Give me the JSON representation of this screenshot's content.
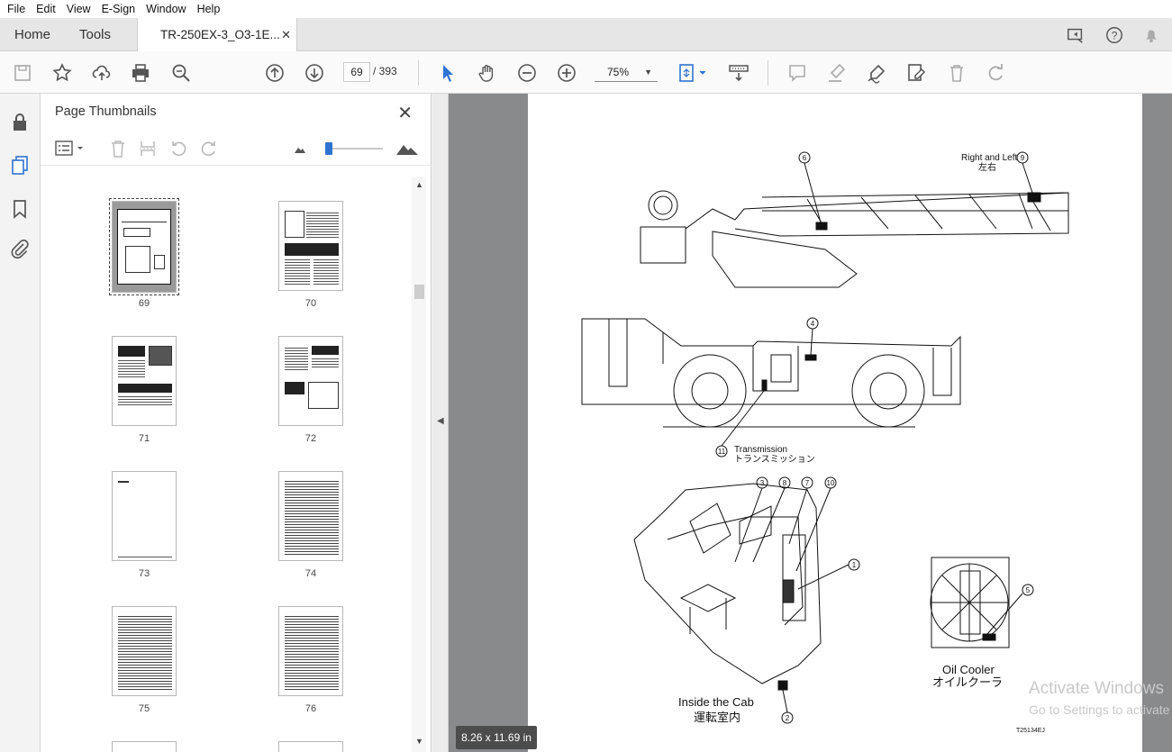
{
  "menu": [
    "File",
    "Edit",
    "View",
    "E-Sign",
    "Window",
    "Help"
  ],
  "tabs": {
    "home": "Home",
    "tools": "Tools",
    "document": "TR-250EX-3_O3-1E..."
  },
  "toolbar": {
    "current_page": "69",
    "page_total": "/ 393",
    "zoom": "75%"
  },
  "panel": {
    "title": "Page Thumbnails",
    "thumbnails": [
      {
        "label": "69",
        "selected": true
      },
      {
        "label": "70",
        "selected": false
      },
      {
        "label": "71",
        "selected": false
      },
      {
        "label": "72",
        "selected": false
      },
      {
        "label": "73",
        "selected": false
      },
      {
        "label": "74",
        "selected": false
      },
      {
        "label": "75",
        "selected": false
      },
      {
        "label": "76",
        "selected": false
      }
    ]
  },
  "viewer": {
    "page_size": "8.26 x 11.69 in",
    "watermark_line1": "Activate Windows",
    "watermark_line2": "Go to Settings to activate Windows."
  },
  "diagram": {
    "label_right_left_en": "Right and Left",
    "label_right_left_jp": "左右",
    "label_transmission_en": "Transmission",
    "label_transmission_jp": "トランスミッション",
    "label_cab_en": "Inside the Cab",
    "label_cab_jp": "運転室内",
    "label_oil_en": "Oil Cooler",
    "label_oil_jp": "オイルクーラ",
    "figure_code": "T25134EJ",
    "callouts": [
      "1",
      "2",
      "3",
      "4",
      "5",
      "6",
      "7",
      "8",
      "9",
      "10",
      "11"
    ]
  },
  "colors": {
    "accent": "#2f73d1",
    "viewer_bg": "#888a8c",
    "panel_bg": "#ffffff"
  },
  "icons": [
    "save-icon",
    "bookmark-star-icon",
    "upload-icon",
    "print-icon",
    "zoom-search-icon",
    "previous-page-icon",
    "next-page-icon",
    "select-cursor-icon",
    "hand-icon",
    "zoom-out-icon",
    "zoom-in-icon",
    "fit-page-icon",
    "scroll-mode-icon",
    "comment-icon",
    "highlight-icon",
    "sign-icon",
    "fill-sign-icon",
    "delete-icon",
    "redo-icon",
    "lock-icon",
    "page-thumbnails-icon",
    "bookmark-icon",
    "attachment-icon"
  ]
}
